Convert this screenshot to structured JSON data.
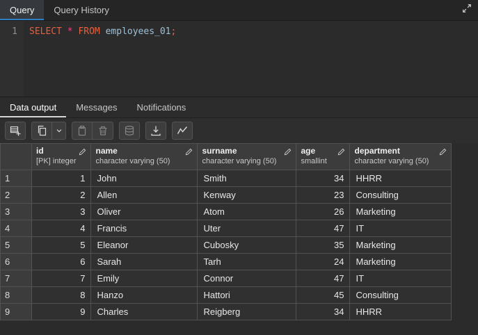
{
  "window": {
    "tabs": [
      {
        "label": "Query",
        "active": true
      },
      {
        "label": "Query History",
        "active": false
      }
    ]
  },
  "editor": {
    "line_number": "1",
    "sql": {
      "select": "SELECT",
      "star": "*",
      "from": "FROM",
      "table": "employees_01",
      "semicolon": ";"
    }
  },
  "output": {
    "tabs": [
      {
        "label": "Data output",
        "active": true
      },
      {
        "label": "Messages",
        "active": false
      },
      {
        "label": "Notifications",
        "active": false
      }
    ]
  },
  "toolbar": {
    "icons": [
      "add-row-icon",
      "copy-icon",
      "chevron-down-icon",
      "paste-icon",
      "delete-icon",
      "save-data-icon",
      "download-icon",
      "graph-icon"
    ]
  },
  "table": {
    "columns": [
      {
        "name": "id",
        "type": "[PK] integer"
      },
      {
        "name": "name",
        "type": "character varying (50)"
      },
      {
        "name": "surname",
        "type": "character varying (50)"
      },
      {
        "name": "age",
        "type": "smallint"
      },
      {
        "name": "department",
        "type": "character varying (50)"
      }
    ],
    "rows": [
      {
        "num": "1",
        "id": "1",
        "name": "John",
        "surname": "Smith",
        "age": "34",
        "department": "HHRR"
      },
      {
        "num": "2",
        "id": "2",
        "name": "Allen",
        "surname": "Kenway",
        "age": "23",
        "department": "Consulting"
      },
      {
        "num": "3",
        "id": "3",
        "name": "Oliver",
        "surname": "Atom",
        "age": "26",
        "department": "Marketing"
      },
      {
        "num": "4",
        "id": "4",
        "name": "Francis",
        "surname": "Uter",
        "age": "47",
        "department": "IT"
      },
      {
        "num": "5",
        "id": "5",
        "name": "Eleanor",
        "surname": "Cubosky",
        "age": "35",
        "department": "Marketing"
      },
      {
        "num": "6",
        "id": "6",
        "name": "Sarah",
        "surname": "Tarh",
        "age": "24",
        "department": "Marketing"
      },
      {
        "num": "7",
        "id": "7",
        "name": "Emily",
        "surname": "Connor",
        "age": "47",
        "department": "IT"
      },
      {
        "num": "8",
        "id": "8",
        "name": "Hanzo",
        "surname": "Hattori",
        "age": "45",
        "department": "Consulting"
      },
      {
        "num": "9",
        "id": "9",
        "name": "Charles",
        "surname": "Reigberg",
        "age": "34",
        "department": "HHRR"
      }
    ]
  },
  "colors": {
    "accent_blue": "#2f80c3",
    "keyword": "#e8603c",
    "star": "#e64586",
    "identifier": "#9fc1d6",
    "header_bg": "#3c3c3c",
    "panel_bg": "#2b2b2b"
  }
}
